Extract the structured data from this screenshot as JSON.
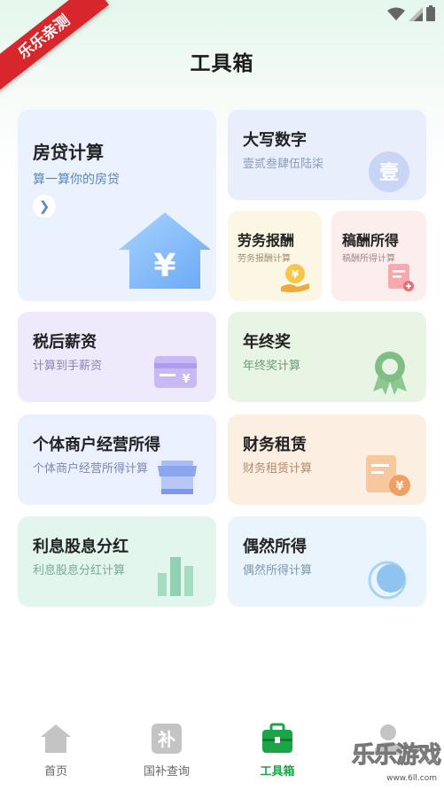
{
  "watermark": {
    "ribbon": "乐乐亲测",
    "brand": "乐乐游戏",
    "url": "www.6ll.com"
  },
  "header": {
    "title": "工具箱"
  },
  "cards": {
    "loan": {
      "title": "房贷计算",
      "subtitle": "算一算你的房贷",
      "icon": "house-yen-icon"
    },
    "bigdigits": {
      "title": "大写数字",
      "subtitle": "壹贰叁肆伍陆柒",
      "icon_char": "壹"
    },
    "labor": {
      "title": "劳务报酬",
      "subtitle": "劳务报酬计算",
      "icon": "coin-hand-icon"
    },
    "royalty": {
      "title": "稿酬所得",
      "subtitle": "稿酬所得计算",
      "icon": "document-plus-icon"
    },
    "salary": {
      "title": "税后薪资",
      "subtitle": "计算到手薪资",
      "icon": "card-yen-icon"
    },
    "bonus": {
      "title": "年终奖",
      "subtitle": "年终奖计算",
      "icon": "award-ribbon-icon"
    },
    "individual": {
      "title": "个体商户经营所得",
      "subtitle": "个体商户经营所得计算",
      "icon": "shop-icon"
    },
    "lease": {
      "title": "财务租赁",
      "subtitle": "财务租赁计算",
      "icon": "invoice-yen-icon"
    },
    "dividend": {
      "title": "利息股息分红",
      "subtitle": "利息股息分红计算",
      "icon": "bar-chart-icon"
    },
    "occasional": {
      "title": "偶然所得",
      "subtitle": "偶然所得计算",
      "icon": "circles-icon"
    }
  },
  "tabs": [
    {
      "label": "首页",
      "icon": "home-icon",
      "active": false
    },
    {
      "label": "国补查询",
      "icon": "bu-icon",
      "icon_char": "补",
      "active": false
    },
    {
      "label": "工具箱",
      "icon": "toolbox-icon",
      "active": true
    },
    {
      "label": "",
      "icon": "profile-icon",
      "active": false
    }
  ],
  "colors": {
    "accent": "#1aa546",
    "inactive": "#bfbfbf"
  }
}
